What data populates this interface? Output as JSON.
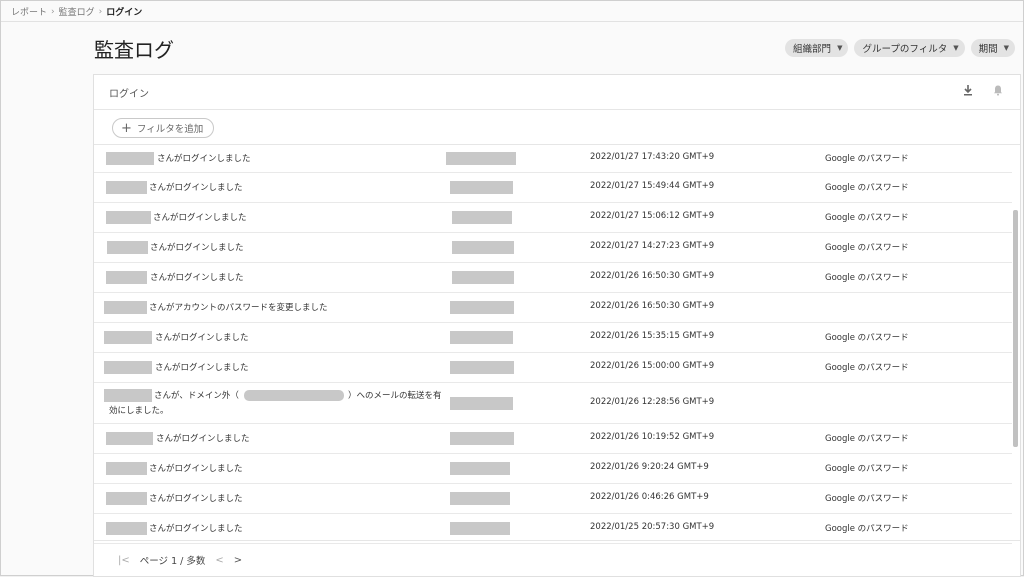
{
  "breadcrumb": {
    "items": [
      "レポート",
      "監査ログ",
      "ログイン"
    ]
  },
  "page": {
    "title": "監査ログ"
  },
  "filters": [
    {
      "label": "組織部門"
    },
    {
      "label": "グループのフィルタ"
    },
    {
      "label": "期間"
    }
  ],
  "card": {
    "title": "ログイン",
    "add_filter": "フィルタを追加"
  },
  "icons": {
    "download": "download-icon",
    "bell": "bell-icon",
    "add": "plus-icon"
  },
  "rows": [
    {
      "desc": "さんがログインしました",
      "time": "2022/01/27 17:43:20 GMT+9",
      "method": "Google のパスワード"
    },
    {
      "desc": "さんがログインしました",
      "time": "2022/01/27 15:49:44 GMT+9",
      "method": "Google のパスワード"
    },
    {
      "desc": "さんがログインしました",
      "time": "2022/01/27 15:06:12 GMT+9",
      "method": "Google のパスワード"
    },
    {
      "desc": "さんがログインしました",
      "time": "2022/01/27 14:27:23 GMT+9",
      "method": "Google のパスワード"
    },
    {
      "desc": "さんがログインしました",
      "time": "2022/01/26 16:50:30 GMT+9",
      "method": "Google のパスワード"
    },
    {
      "desc": "さんがアカウントのパスワードを変更しました",
      "time": "2022/01/26 16:50:30 GMT+9",
      "method": ""
    },
    {
      "desc": "さんがログインしました",
      "time": "2022/01/26 15:35:15 GMT+9",
      "method": "Google のパスワード"
    },
    {
      "desc": "さんがログインしました",
      "time": "2022/01/26 15:00:00 GMT+9",
      "method": "Google のパスワード"
    },
    {
      "desc": "さんが、ドメイン外（",
      "desc_tail": "）へのメールの転送を有",
      "desc_line2": "効にしました。",
      "time": "2022/01/26 12:28:56 GMT+9",
      "method": ""
    },
    {
      "desc": "さんがログインしました",
      "time": "2022/01/26 10:19:52 GMT+9",
      "method": "Google のパスワード"
    },
    {
      "desc": "さんがログインしました",
      "time": "2022/01/26 9:20:24 GMT+9",
      "method": "Google のパスワード"
    },
    {
      "desc": "さんがログインしました",
      "time": "2022/01/26 0:46:26 GMT+9",
      "method": "Google のパスワード"
    },
    {
      "desc": "さんがログインしました",
      "time": "2022/01/25 20:57:30 GMT+9",
      "method": "Google のパスワード"
    }
  ],
  "pager": {
    "label": "ページ 1 / 多数",
    "first": "|<",
    "prev": "<",
    "next": ">"
  }
}
